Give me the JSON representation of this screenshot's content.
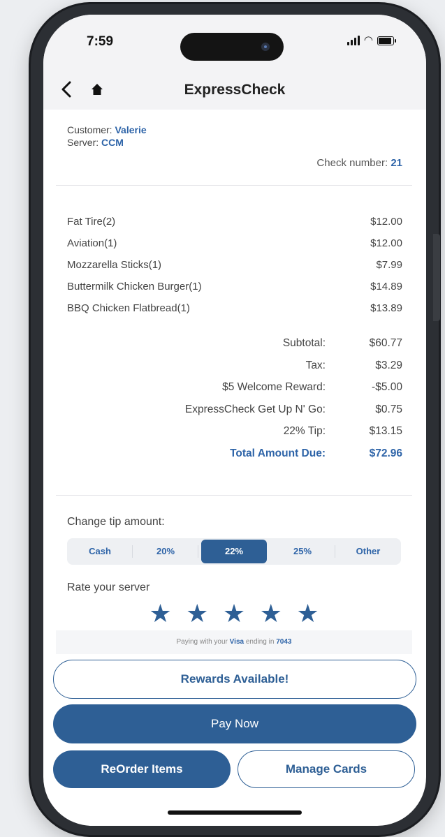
{
  "status": {
    "time": "7:59"
  },
  "nav": {
    "title": "ExpressCheck",
    "back_icon": "chevron-left-icon",
    "home_icon": "home-icon"
  },
  "check": {
    "customer_label": "Customer: ",
    "customer_name": "Valerie",
    "server_label": "Server: ",
    "server_name": "CCM",
    "check_number_label": "Check number: ",
    "check_number": "21"
  },
  "items": [
    {
      "name": "Fat Tire(2)",
      "price": "$12.00"
    },
    {
      "name": "Aviation(1)",
      "price": "$12.00"
    },
    {
      "name": "Mozzarella Sticks(1)",
      "price": "$7.99"
    },
    {
      "name": "Buttermilk Chicken Burger(1)",
      "price": "$14.89"
    },
    {
      "name": "BBQ Chicken Flatbread(1)",
      "price": "$13.89"
    }
  ],
  "totals": [
    {
      "label": "Subtotal:",
      "value": "$60.77"
    },
    {
      "label": "Tax:",
      "value": "$3.29"
    },
    {
      "label": "$5 Welcome Reward:",
      "value": "-$5.00"
    },
    {
      "label": "ExpressCheck Get Up N' Go:",
      "value": "$0.75"
    },
    {
      "label": "22% Tip:",
      "value": "$13.15"
    },
    {
      "label": "Total Amount Due:",
      "value": "$72.96"
    }
  ],
  "tip": {
    "label": "Change tip amount:",
    "options": [
      "Cash",
      "20%",
      "22%",
      "25%",
      "Other"
    ],
    "selected": "22%"
  },
  "rating": {
    "label": "Rate your server",
    "stars": 5,
    "max": 5
  },
  "payment": {
    "prefix": "Paying with your ",
    "card": "Visa",
    "middle": " ending in ",
    "last4": "7043"
  },
  "buttons": {
    "rewards": "Rewards Available!",
    "pay": "Pay Now",
    "reorder": "ReOrder Items",
    "manage": "Manage Cards"
  },
  "colors": {
    "accent": "#2e5f95",
    "link": "#2e64a8"
  }
}
